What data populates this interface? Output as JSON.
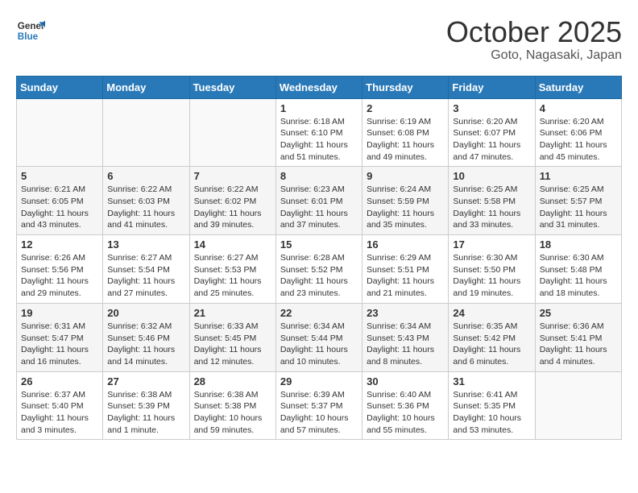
{
  "header": {
    "logo_general": "General",
    "logo_blue": "Blue",
    "month": "October 2025",
    "location": "Goto, Nagasaki, Japan"
  },
  "days_of_week": [
    "Sunday",
    "Monday",
    "Tuesday",
    "Wednesday",
    "Thursday",
    "Friday",
    "Saturday"
  ],
  "weeks": [
    [
      {
        "day": "",
        "info": ""
      },
      {
        "day": "",
        "info": ""
      },
      {
        "day": "",
        "info": ""
      },
      {
        "day": "1",
        "info": "Sunrise: 6:18 AM\nSunset: 6:10 PM\nDaylight: 11 hours\nand 51 minutes."
      },
      {
        "day": "2",
        "info": "Sunrise: 6:19 AM\nSunset: 6:08 PM\nDaylight: 11 hours\nand 49 minutes."
      },
      {
        "day": "3",
        "info": "Sunrise: 6:20 AM\nSunset: 6:07 PM\nDaylight: 11 hours\nand 47 minutes."
      },
      {
        "day": "4",
        "info": "Sunrise: 6:20 AM\nSunset: 6:06 PM\nDaylight: 11 hours\nand 45 minutes."
      }
    ],
    [
      {
        "day": "5",
        "info": "Sunrise: 6:21 AM\nSunset: 6:05 PM\nDaylight: 11 hours\nand 43 minutes."
      },
      {
        "day": "6",
        "info": "Sunrise: 6:22 AM\nSunset: 6:03 PM\nDaylight: 11 hours\nand 41 minutes."
      },
      {
        "day": "7",
        "info": "Sunrise: 6:22 AM\nSunset: 6:02 PM\nDaylight: 11 hours\nand 39 minutes."
      },
      {
        "day": "8",
        "info": "Sunrise: 6:23 AM\nSunset: 6:01 PM\nDaylight: 11 hours\nand 37 minutes."
      },
      {
        "day": "9",
        "info": "Sunrise: 6:24 AM\nSunset: 5:59 PM\nDaylight: 11 hours\nand 35 minutes."
      },
      {
        "day": "10",
        "info": "Sunrise: 6:25 AM\nSunset: 5:58 PM\nDaylight: 11 hours\nand 33 minutes."
      },
      {
        "day": "11",
        "info": "Sunrise: 6:25 AM\nSunset: 5:57 PM\nDaylight: 11 hours\nand 31 minutes."
      }
    ],
    [
      {
        "day": "12",
        "info": "Sunrise: 6:26 AM\nSunset: 5:56 PM\nDaylight: 11 hours\nand 29 minutes."
      },
      {
        "day": "13",
        "info": "Sunrise: 6:27 AM\nSunset: 5:54 PM\nDaylight: 11 hours\nand 27 minutes."
      },
      {
        "day": "14",
        "info": "Sunrise: 6:27 AM\nSunset: 5:53 PM\nDaylight: 11 hours\nand 25 minutes."
      },
      {
        "day": "15",
        "info": "Sunrise: 6:28 AM\nSunset: 5:52 PM\nDaylight: 11 hours\nand 23 minutes."
      },
      {
        "day": "16",
        "info": "Sunrise: 6:29 AM\nSunset: 5:51 PM\nDaylight: 11 hours\nand 21 minutes."
      },
      {
        "day": "17",
        "info": "Sunrise: 6:30 AM\nSunset: 5:50 PM\nDaylight: 11 hours\nand 19 minutes."
      },
      {
        "day": "18",
        "info": "Sunrise: 6:30 AM\nSunset: 5:48 PM\nDaylight: 11 hours\nand 18 minutes."
      }
    ],
    [
      {
        "day": "19",
        "info": "Sunrise: 6:31 AM\nSunset: 5:47 PM\nDaylight: 11 hours\nand 16 minutes."
      },
      {
        "day": "20",
        "info": "Sunrise: 6:32 AM\nSunset: 5:46 PM\nDaylight: 11 hours\nand 14 minutes."
      },
      {
        "day": "21",
        "info": "Sunrise: 6:33 AM\nSunset: 5:45 PM\nDaylight: 11 hours\nand 12 minutes."
      },
      {
        "day": "22",
        "info": "Sunrise: 6:34 AM\nSunset: 5:44 PM\nDaylight: 11 hours\nand 10 minutes."
      },
      {
        "day": "23",
        "info": "Sunrise: 6:34 AM\nSunset: 5:43 PM\nDaylight: 11 hours\nand 8 minutes."
      },
      {
        "day": "24",
        "info": "Sunrise: 6:35 AM\nSunset: 5:42 PM\nDaylight: 11 hours\nand 6 minutes."
      },
      {
        "day": "25",
        "info": "Sunrise: 6:36 AM\nSunset: 5:41 PM\nDaylight: 11 hours\nand 4 minutes."
      }
    ],
    [
      {
        "day": "26",
        "info": "Sunrise: 6:37 AM\nSunset: 5:40 PM\nDaylight: 11 hours\nand 3 minutes."
      },
      {
        "day": "27",
        "info": "Sunrise: 6:38 AM\nSunset: 5:39 PM\nDaylight: 11 hours\nand 1 minute."
      },
      {
        "day": "28",
        "info": "Sunrise: 6:38 AM\nSunset: 5:38 PM\nDaylight: 10 hours\nand 59 minutes."
      },
      {
        "day": "29",
        "info": "Sunrise: 6:39 AM\nSunset: 5:37 PM\nDaylight: 10 hours\nand 57 minutes."
      },
      {
        "day": "30",
        "info": "Sunrise: 6:40 AM\nSunset: 5:36 PM\nDaylight: 10 hours\nand 55 minutes."
      },
      {
        "day": "31",
        "info": "Sunrise: 6:41 AM\nSunset: 5:35 PM\nDaylight: 10 hours\nand 53 minutes."
      },
      {
        "day": "",
        "info": ""
      }
    ]
  ]
}
